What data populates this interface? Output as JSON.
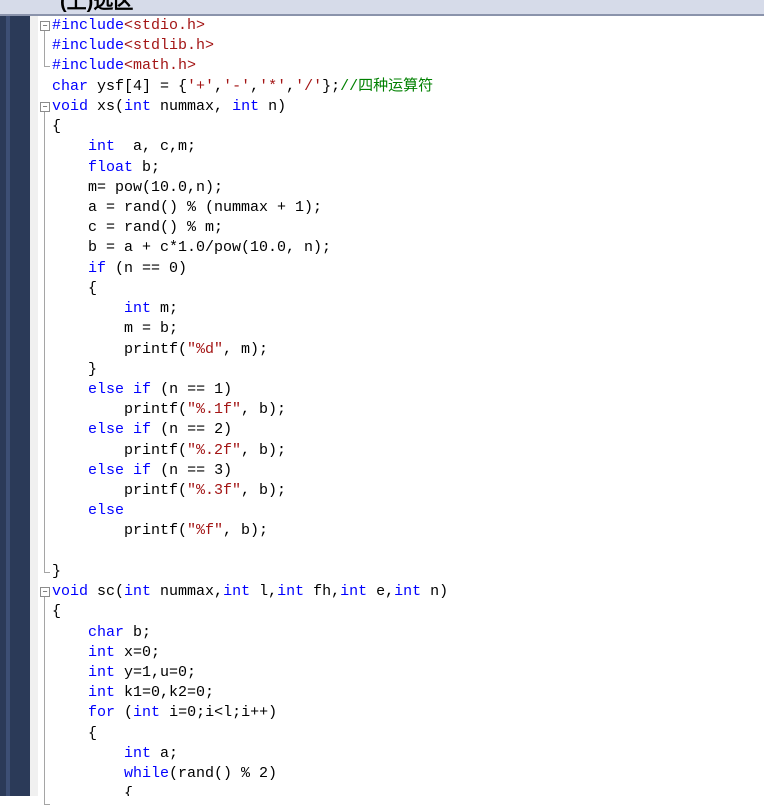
{
  "window": {
    "title": "(上)选区"
  },
  "code_lines": [
    [
      {
        "t": "#include",
        "c": "pp"
      },
      {
        "t": "<stdio.h>",
        "c": "str"
      }
    ],
    [
      {
        "t": "#include",
        "c": "pp"
      },
      {
        "t": "<stdlib.h>",
        "c": "str"
      }
    ],
    [
      {
        "t": "#include",
        "c": "pp"
      },
      {
        "t": "<math.h>",
        "c": "str"
      }
    ],
    [
      {
        "t": "char",
        "c": "kw"
      },
      {
        "t": " ysf[4] = {",
        "c": ""
      },
      {
        "t": "'+'",
        "c": "str"
      },
      {
        "t": ",",
        "c": ""
      },
      {
        "t": "'-'",
        "c": "str"
      },
      {
        "t": ",",
        "c": ""
      },
      {
        "t": "'*'",
        "c": "str"
      },
      {
        "t": ",",
        "c": ""
      },
      {
        "t": "'/'",
        "c": "str"
      },
      {
        "t": "};",
        "c": ""
      },
      {
        "t": "//四种运算符",
        "c": "cm"
      }
    ],
    [
      {
        "t": "void",
        "c": "kw"
      },
      {
        "t": " xs(",
        "c": ""
      },
      {
        "t": "int",
        "c": "kw"
      },
      {
        "t": " nummax, ",
        "c": ""
      },
      {
        "t": "int",
        "c": "kw"
      },
      {
        "t": " n)",
        "c": ""
      }
    ],
    [
      {
        "t": "{",
        "c": ""
      }
    ],
    [
      {
        "t": "    ",
        "c": ""
      },
      {
        "t": "int",
        "c": "kw"
      },
      {
        "t": "  a, c,m;",
        "c": ""
      }
    ],
    [
      {
        "t": "    ",
        "c": ""
      },
      {
        "t": "float",
        "c": "kw"
      },
      {
        "t": " b;",
        "c": ""
      }
    ],
    [
      {
        "t": "    m= pow(10.0,n);",
        "c": ""
      }
    ],
    [
      {
        "t": "    a = rand() % (nummax + 1);",
        "c": ""
      }
    ],
    [
      {
        "t": "    c = rand() % m;",
        "c": ""
      }
    ],
    [
      {
        "t": "    b = a + c*1.0/pow(10.0, n);",
        "c": ""
      }
    ],
    [
      {
        "t": "    ",
        "c": ""
      },
      {
        "t": "if",
        "c": "kw"
      },
      {
        "t": " (n == 0)",
        "c": ""
      }
    ],
    [
      {
        "t": "    {",
        "c": ""
      }
    ],
    [
      {
        "t": "        ",
        "c": ""
      },
      {
        "t": "int",
        "c": "kw"
      },
      {
        "t": " m;",
        "c": ""
      }
    ],
    [
      {
        "t": "        m = b;",
        "c": ""
      }
    ],
    [
      {
        "t": "        printf(",
        "c": ""
      },
      {
        "t": "\"%d\"",
        "c": "str"
      },
      {
        "t": ", m);",
        "c": ""
      }
    ],
    [
      {
        "t": "    }",
        "c": ""
      }
    ],
    [
      {
        "t": "    ",
        "c": ""
      },
      {
        "t": "else",
        "c": "kw"
      },
      {
        "t": " ",
        "c": ""
      },
      {
        "t": "if",
        "c": "kw"
      },
      {
        "t": " (n == 1)",
        "c": ""
      }
    ],
    [
      {
        "t": "        printf(",
        "c": ""
      },
      {
        "t": "\"%.1f\"",
        "c": "str"
      },
      {
        "t": ", b);",
        "c": ""
      }
    ],
    [
      {
        "t": "    ",
        "c": ""
      },
      {
        "t": "else",
        "c": "kw"
      },
      {
        "t": " ",
        "c": ""
      },
      {
        "t": "if",
        "c": "kw"
      },
      {
        "t": " (n == 2)",
        "c": ""
      }
    ],
    [
      {
        "t": "        printf(",
        "c": ""
      },
      {
        "t": "\"%.2f\"",
        "c": "str"
      },
      {
        "t": ", b);",
        "c": ""
      }
    ],
    [
      {
        "t": "    ",
        "c": ""
      },
      {
        "t": "else",
        "c": "kw"
      },
      {
        "t": " ",
        "c": ""
      },
      {
        "t": "if",
        "c": "kw"
      },
      {
        "t": " (n == 3)",
        "c": ""
      }
    ],
    [
      {
        "t": "        printf(",
        "c": ""
      },
      {
        "t": "\"%.3f\"",
        "c": "str"
      },
      {
        "t": ", b);",
        "c": ""
      }
    ],
    [
      {
        "t": "    ",
        "c": ""
      },
      {
        "t": "else",
        "c": "kw"
      }
    ],
    [
      {
        "t": "        printf(",
        "c": ""
      },
      {
        "t": "\"%f\"",
        "c": "str"
      },
      {
        "t": ", b);",
        "c": ""
      }
    ],
    [
      {
        "t": "",
        "c": ""
      }
    ],
    [
      {
        "t": "}",
        "c": ""
      }
    ],
    [
      {
        "t": "void",
        "c": "kw"
      },
      {
        "t": " sc(",
        "c": ""
      },
      {
        "t": "int",
        "c": "kw"
      },
      {
        "t": " nummax,",
        "c": ""
      },
      {
        "t": "int",
        "c": "kw"
      },
      {
        "t": " l,",
        "c": ""
      },
      {
        "t": "int",
        "c": "kw"
      },
      {
        "t": " fh,",
        "c": ""
      },
      {
        "t": "int",
        "c": "kw"
      },
      {
        "t": " e,",
        "c": ""
      },
      {
        "t": "int",
        "c": "kw"
      },
      {
        "t": " n)",
        "c": ""
      }
    ],
    [
      {
        "t": "{",
        "c": ""
      }
    ],
    [
      {
        "t": "    ",
        "c": ""
      },
      {
        "t": "char",
        "c": "kw"
      },
      {
        "t": " b;",
        "c": ""
      }
    ],
    [
      {
        "t": "    ",
        "c": ""
      },
      {
        "t": "int",
        "c": "kw"
      },
      {
        "t": " x=0;",
        "c": ""
      }
    ],
    [
      {
        "t": "    ",
        "c": ""
      },
      {
        "t": "int",
        "c": "kw"
      },
      {
        "t": " y=1,u=0;",
        "c": ""
      }
    ],
    [
      {
        "t": "    ",
        "c": ""
      },
      {
        "t": "int",
        "c": "kw"
      },
      {
        "t": " k1=0,k2=0;",
        "c": ""
      }
    ],
    [
      {
        "t": "    ",
        "c": ""
      },
      {
        "t": "for",
        "c": "kw"
      },
      {
        "t": " (",
        "c": ""
      },
      {
        "t": "int",
        "c": "kw"
      },
      {
        "t": " i=0;i<l;i++)",
        "c": ""
      }
    ],
    [
      {
        "t": "    {",
        "c": ""
      }
    ],
    [
      {
        "t": "        ",
        "c": ""
      },
      {
        "t": "int",
        "c": "kw"
      },
      {
        "t": " a;",
        "c": ""
      }
    ],
    [
      {
        "t": "        ",
        "c": ""
      },
      {
        "t": "while",
        "c": "kw"
      },
      {
        "t": "(rand() % 2)",
        "c": ""
      }
    ],
    [
      {
        "t": "        {",
        "c": ""
      }
    ]
  ],
  "folding": {
    "collapse_icon": "minus-box-icon",
    "collapse_glyph": "−"
  },
  "colors": {
    "keyword": "#0000ff",
    "string": "#a31515",
    "comment": "#008000",
    "text": "#000000",
    "frame": "#2b3a58"
  }
}
